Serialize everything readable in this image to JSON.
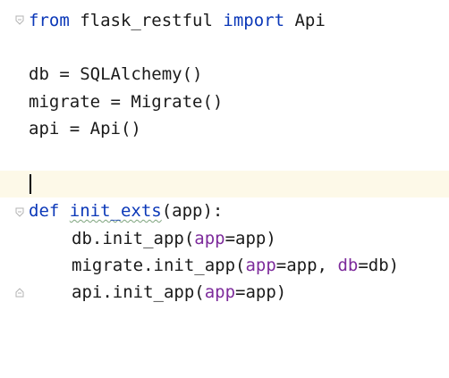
{
  "editor": {
    "lines": [
      {
        "keyword": "from",
        "module": "flask_restful",
        "keyword2": "import",
        "name": "Api"
      },
      {
        "text": ""
      },
      {
        "text": "db = SQLAlchemy()"
      },
      {
        "text": "migrate = Migrate()"
      },
      {
        "text": "api = Api()"
      },
      {
        "text": ""
      },
      {
        "text": ""
      },
      {
        "keyword": "def",
        "fn_name": "init_exts",
        "args": "(app):"
      },
      {
        "obj": "db.init_app(",
        "param": "app",
        "rest": "=app)"
      },
      {
        "obj": "migrate.init_app(",
        "param1": "app",
        "mid": "=app, ",
        "param2": "db",
        "rest": "=db)"
      },
      {
        "obj": "api.init_app(",
        "param": "app",
        "rest": "=app)"
      }
    ]
  },
  "colors": {
    "keyword": "#0b38b8",
    "parameter": "#7d2b9b",
    "current_line": "#fdf9e8"
  },
  "icons": [
    "fold-marker-icon",
    "fold-end-icon",
    "text-caret-icon"
  ]
}
